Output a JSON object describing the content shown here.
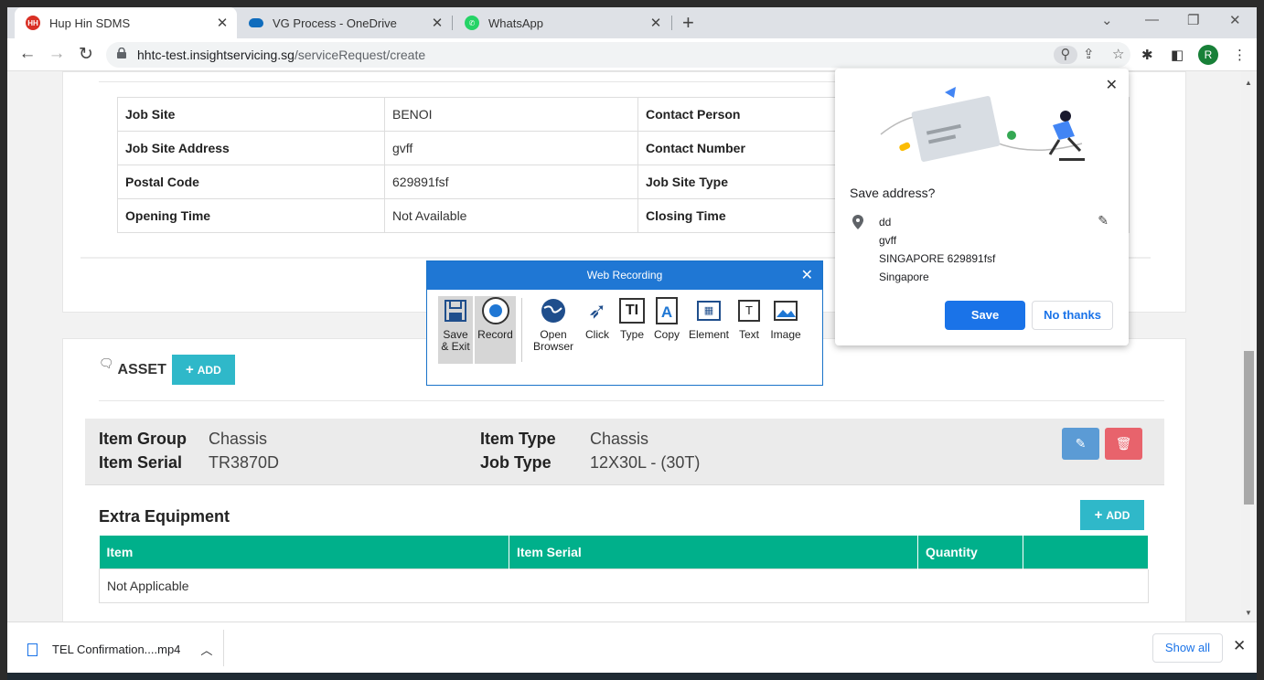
{
  "tabs": [
    {
      "title": "Hup Hin SDMS",
      "favicon": "hh-logo-icon",
      "active": true
    },
    {
      "title": "VG Process - OneDrive",
      "favicon": "onedrive-icon"
    },
    {
      "title": "WhatsApp",
      "favicon": "whatsapp-icon"
    }
  ],
  "addressbar": {
    "host": "hhtc-test.insightservicing.sg",
    "path": "/serviceRequest/create",
    "profile_initial": "R"
  },
  "site_info": {
    "rows": [
      {
        "k1": "Job Site",
        "v1": "BENOI",
        "k2": "Contact Person"
      },
      {
        "k1": "Job Site Address",
        "v1": "gvff",
        "k2": "Contact Number"
      },
      {
        "k1": "Postal Code",
        "v1": "629891fsf",
        "k2": "Job Site Type"
      },
      {
        "k1": "Opening Time",
        "v1": "Not Available",
        "k2": "Closing Time"
      }
    ]
  },
  "asset": {
    "title": "ASSET",
    "add_label": "ADD",
    "item": {
      "group_label": "Item Group",
      "group_value": "Chassis",
      "serial_label": "Item Serial",
      "serial_value": "TR3870D",
      "type_label": "Item Type",
      "type_value": "Chassis",
      "job_label": "Job Type",
      "job_value": "12X30L - (30T)"
    }
  },
  "extra_equipment": {
    "title": "Extra Equipment",
    "add_label": "ADD",
    "columns": [
      "Item",
      "Item Serial",
      "Quantity"
    ],
    "empty_text": "Not Applicable"
  },
  "web_recording": {
    "title": "Web Recording",
    "tools": [
      "Save\n& Exit",
      "Record",
      "Open\nBrowser",
      "Click",
      "Type",
      "Copy",
      "Element",
      "Text",
      "Image"
    ]
  },
  "save_address": {
    "title": "Save address?",
    "lines": [
      "dd",
      "gvff",
      "SINGAPORE 629891fsf",
      "Singapore"
    ],
    "save_label": "Save",
    "no_label": "No thanks"
  },
  "download": {
    "file": "TEL Confirmation....mp4",
    "show_all": "Show all"
  },
  "colors": {
    "teal": "#2fb8c9",
    "green_header": "#00b08b",
    "edit_blue": "#5b9bd5",
    "delete_red": "#e8636c",
    "chrome_blue": "#1a73e8"
  }
}
